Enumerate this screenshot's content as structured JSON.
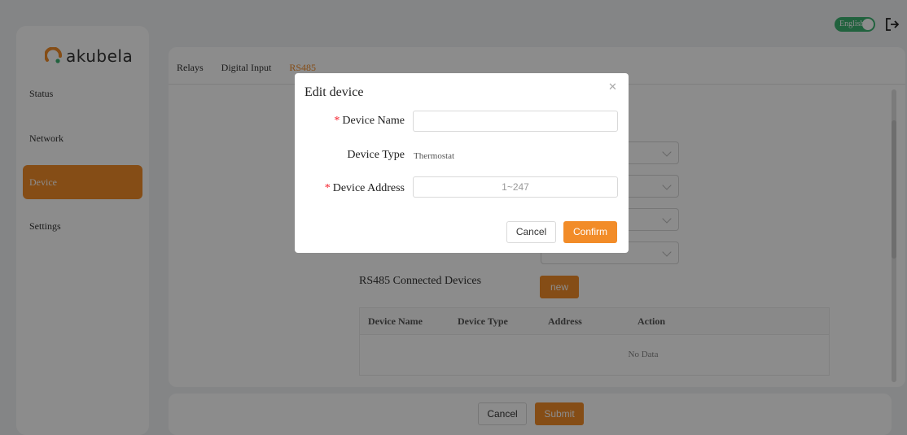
{
  "header": {
    "language_label": "English",
    "logout_icon": "logout-icon"
  },
  "sidebar": {
    "logo_text": "akubela",
    "items": [
      {
        "label": "Status",
        "active": false
      },
      {
        "label": "Network",
        "active": false
      },
      {
        "label": "Device",
        "active": true
      },
      {
        "label": "Settings",
        "active": false
      }
    ]
  },
  "tabs": [
    {
      "label": "Relays",
      "active": false
    },
    {
      "label": "Digital Input",
      "active": false
    },
    {
      "label": "RS485",
      "active": true
    }
  ],
  "rs485": {
    "connected_label": "RS485 Connected Devices",
    "new_button": "new",
    "table": {
      "columns": [
        "Device Name",
        "Device Type",
        "Address",
        "Action"
      ],
      "empty_text": "No Data"
    }
  },
  "footer": {
    "cancel_label": "Cancel",
    "submit_label": "Submit"
  },
  "modal": {
    "title": "Edit device",
    "close_icon": "close-icon",
    "device_name_label": "Device Name",
    "device_name_value": "",
    "device_type_label": "Device Type",
    "device_type_value": "Thermostat",
    "device_address_label": "Device Address",
    "device_address_placeholder": "1~247",
    "cancel_label": "Cancel",
    "confirm_label": "Confirm"
  },
  "colors": {
    "accent": "#f28c28",
    "toggle_on": "#3cb371",
    "required": "#f5222d"
  }
}
